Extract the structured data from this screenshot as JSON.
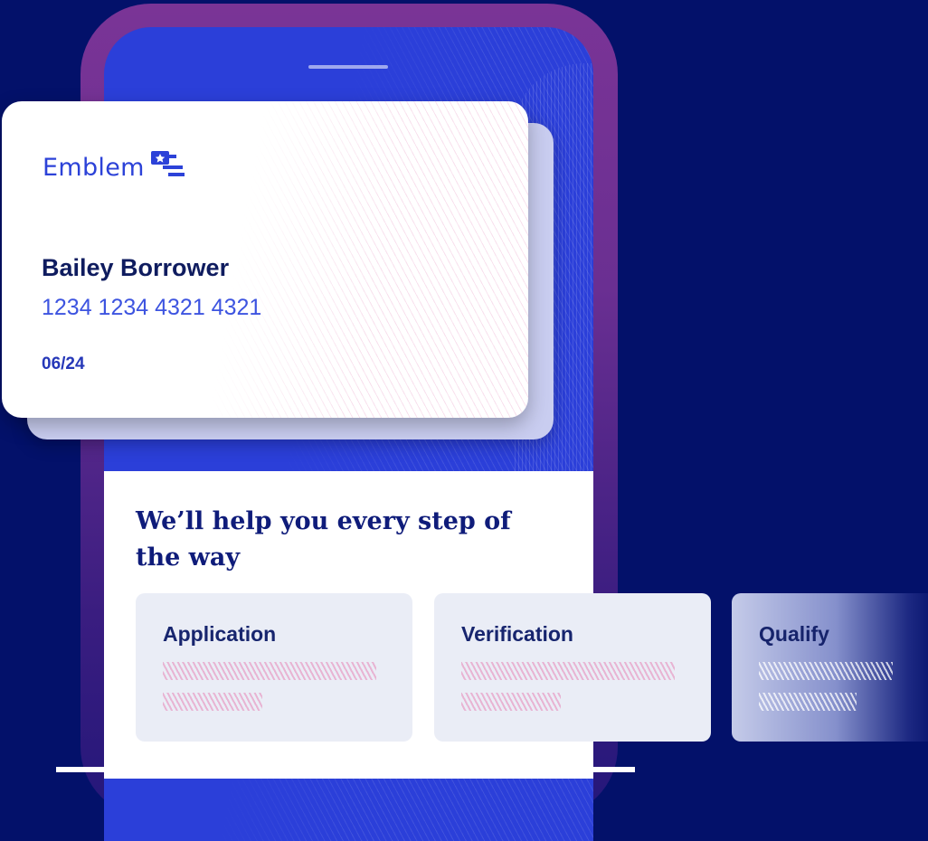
{
  "card": {
    "brand": "Emblem",
    "holder_name": "Bailey Borrower",
    "card_number": "1234 1234 4321 4321",
    "expiry": "06/24"
  },
  "headline": "We’ll help you every step of the way",
  "steps": [
    {
      "label": "Application"
    },
    {
      "label": "Verification"
    },
    {
      "label": "Qualify"
    }
  ],
  "icons": {
    "logo": "flag-logo-icon"
  },
  "colors": {
    "background": "#03116a",
    "screen": "#2b3fd9",
    "brand_blue": "#2c42d8",
    "frame_purple": "#7a3496",
    "headline": "#0f1c7a"
  }
}
